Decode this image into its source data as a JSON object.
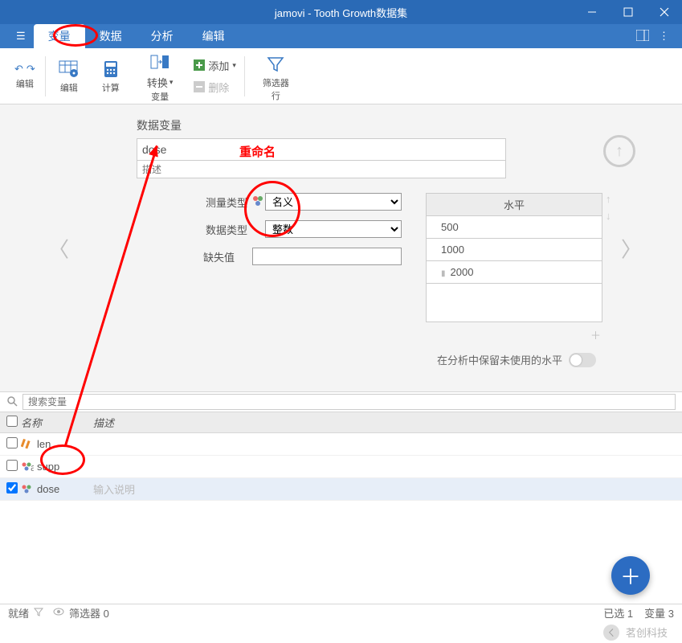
{
  "title": "jamovi - Tooth Growth数据集",
  "menu": {
    "tabs": [
      "变量",
      "数据",
      "分析",
      "编辑"
    ],
    "active": 0
  },
  "ribbon": {
    "edit_group": "编辑",
    "btn_setup": "编辑",
    "btn_compute": "计算",
    "btn_transform": "转换",
    "var_group": "变量",
    "add": "添加",
    "delete": "删除",
    "btn_filter": "筛选器",
    "row_group": "行"
  },
  "varpanel": {
    "heading": "数据变量",
    "name": "dose",
    "rename_tag": "重命名",
    "desc_placeholder": "描述",
    "measure_label": "测量类型",
    "measure_value": "名义",
    "datatype_label": "数据类型",
    "datatype_value": "整数",
    "missing_label": "缺失值",
    "levels_header": "水平",
    "levels": [
      "500",
      "1000",
      "2000"
    ],
    "keep_unused": "在分析中保留未使用的水平"
  },
  "search_placeholder": "搜索变量",
  "list_head": {
    "name": "名称",
    "desc": "描述"
  },
  "rows": [
    {
      "checked": false,
      "name": "len",
      "icon": "ruler",
      "desc": ""
    },
    {
      "checked": false,
      "name": "supp",
      "icon": "cat",
      "desc": ""
    },
    {
      "checked": true,
      "name": "dose",
      "icon": "cat",
      "desc_placeholder": "输入说明"
    }
  ],
  "status": {
    "ready": "就绪",
    "filter": "筛选器 0",
    "sel": "已选 1",
    "vars": "变量 3"
  },
  "watermark": "茗创科技"
}
